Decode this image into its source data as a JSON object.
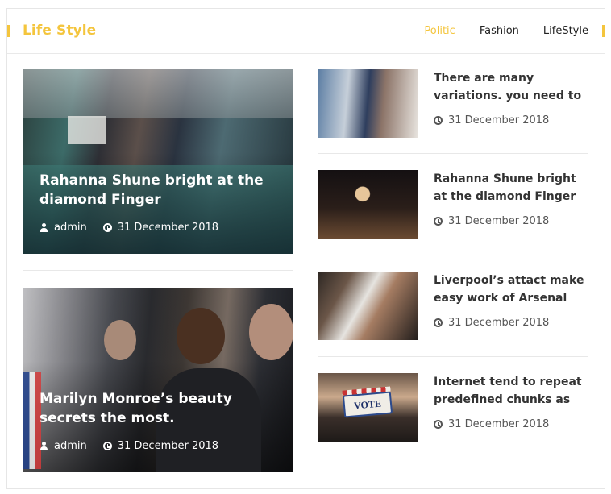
{
  "header": {
    "title": "Life Style",
    "tabs": [
      {
        "label": "Politic",
        "active": true
      },
      {
        "label": "Fashion",
        "active": false
      },
      {
        "label": "LifeStyle",
        "active": false
      }
    ],
    "accent": "#f4c53d"
  },
  "featured": [
    {
      "title": "Rahanna Shune bright at the diamond Finger",
      "author": "admin",
      "date": "31 December 2018",
      "author_icon": "user-icon",
      "date_icon": "clock-icon"
    },
    {
      "title": "Marilyn Monroe’s beauty secrets the most.",
      "author": "admin",
      "date": "31 December 2018",
      "author_icon": "user-icon",
      "date_icon": "clock-icon"
    }
  ],
  "list": [
    {
      "title": "There are many variations. you need to",
      "date": "31 December 2018"
    },
    {
      "title": "Rahanna Shune bright at the diamond Finger",
      "date": "31 December 2018"
    },
    {
      "title": "Liverpool’s attact make easy work of Arsenal",
      "date": "31 December 2018"
    },
    {
      "title": "Internet tend to repeat predefined chunks as",
      "date": "31 December 2018",
      "image_text": "VOTE"
    }
  ]
}
